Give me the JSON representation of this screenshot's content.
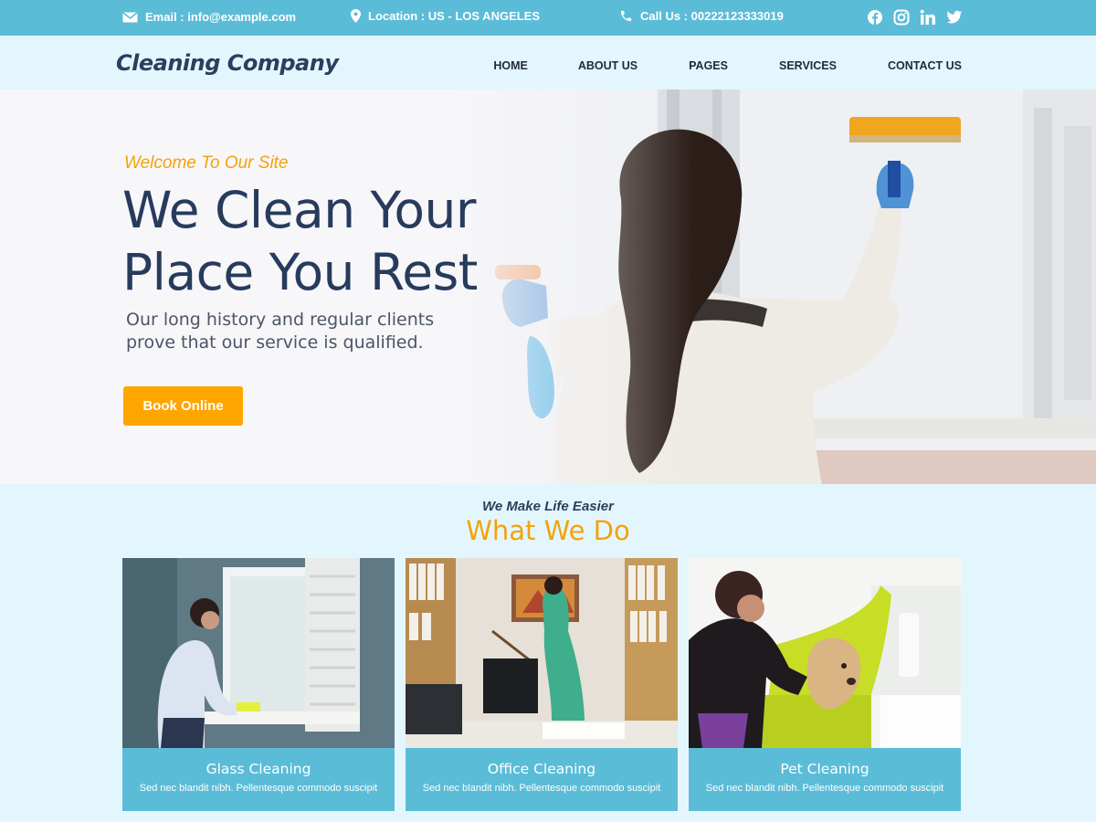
{
  "topbar": {
    "email": "Email : info@example.com",
    "location": "Location : US - LOS ANGELES",
    "phone": "Call Us : 00222123333019",
    "socials": [
      "facebook-icon",
      "instagram-icon",
      "linkedin-icon",
      "twitter-icon"
    ]
  },
  "header": {
    "logo": "Cleaning Company",
    "nav": [
      "HOME",
      "ABOUT US",
      "PAGES",
      "SERVICES",
      "CONTACT US"
    ]
  },
  "hero": {
    "welcome": "Welcome To Our Site",
    "title_line1": "We Clean Your",
    "title_line2": "Place You Rest",
    "sub_line1": "Our long history and regular clients",
    "sub_line2": "prove that our service is qualified.",
    "button": "Book Online"
  },
  "services": {
    "tagline": "We Make Life Easier",
    "title": "What We Do",
    "cards": [
      {
        "title": "Glass Cleaning",
        "desc": "Sed nec blandit nibh. Pellentesque commodo suscipit"
      },
      {
        "title": "Office Cleaning",
        "desc": "Sed nec blandit nibh. Pellentesque commodo suscipit"
      },
      {
        "title": "Pet Cleaning",
        "desc": "Sed nec blandit nibh. Pellentesque commodo suscipit"
      }
    ]
  },
  "colors": {
    "topbar": "#5bbcd8",
    "accent": "#ffa500",
    "heading": "#273b5c",
    "background": "#e4f6fd"
  }
}
